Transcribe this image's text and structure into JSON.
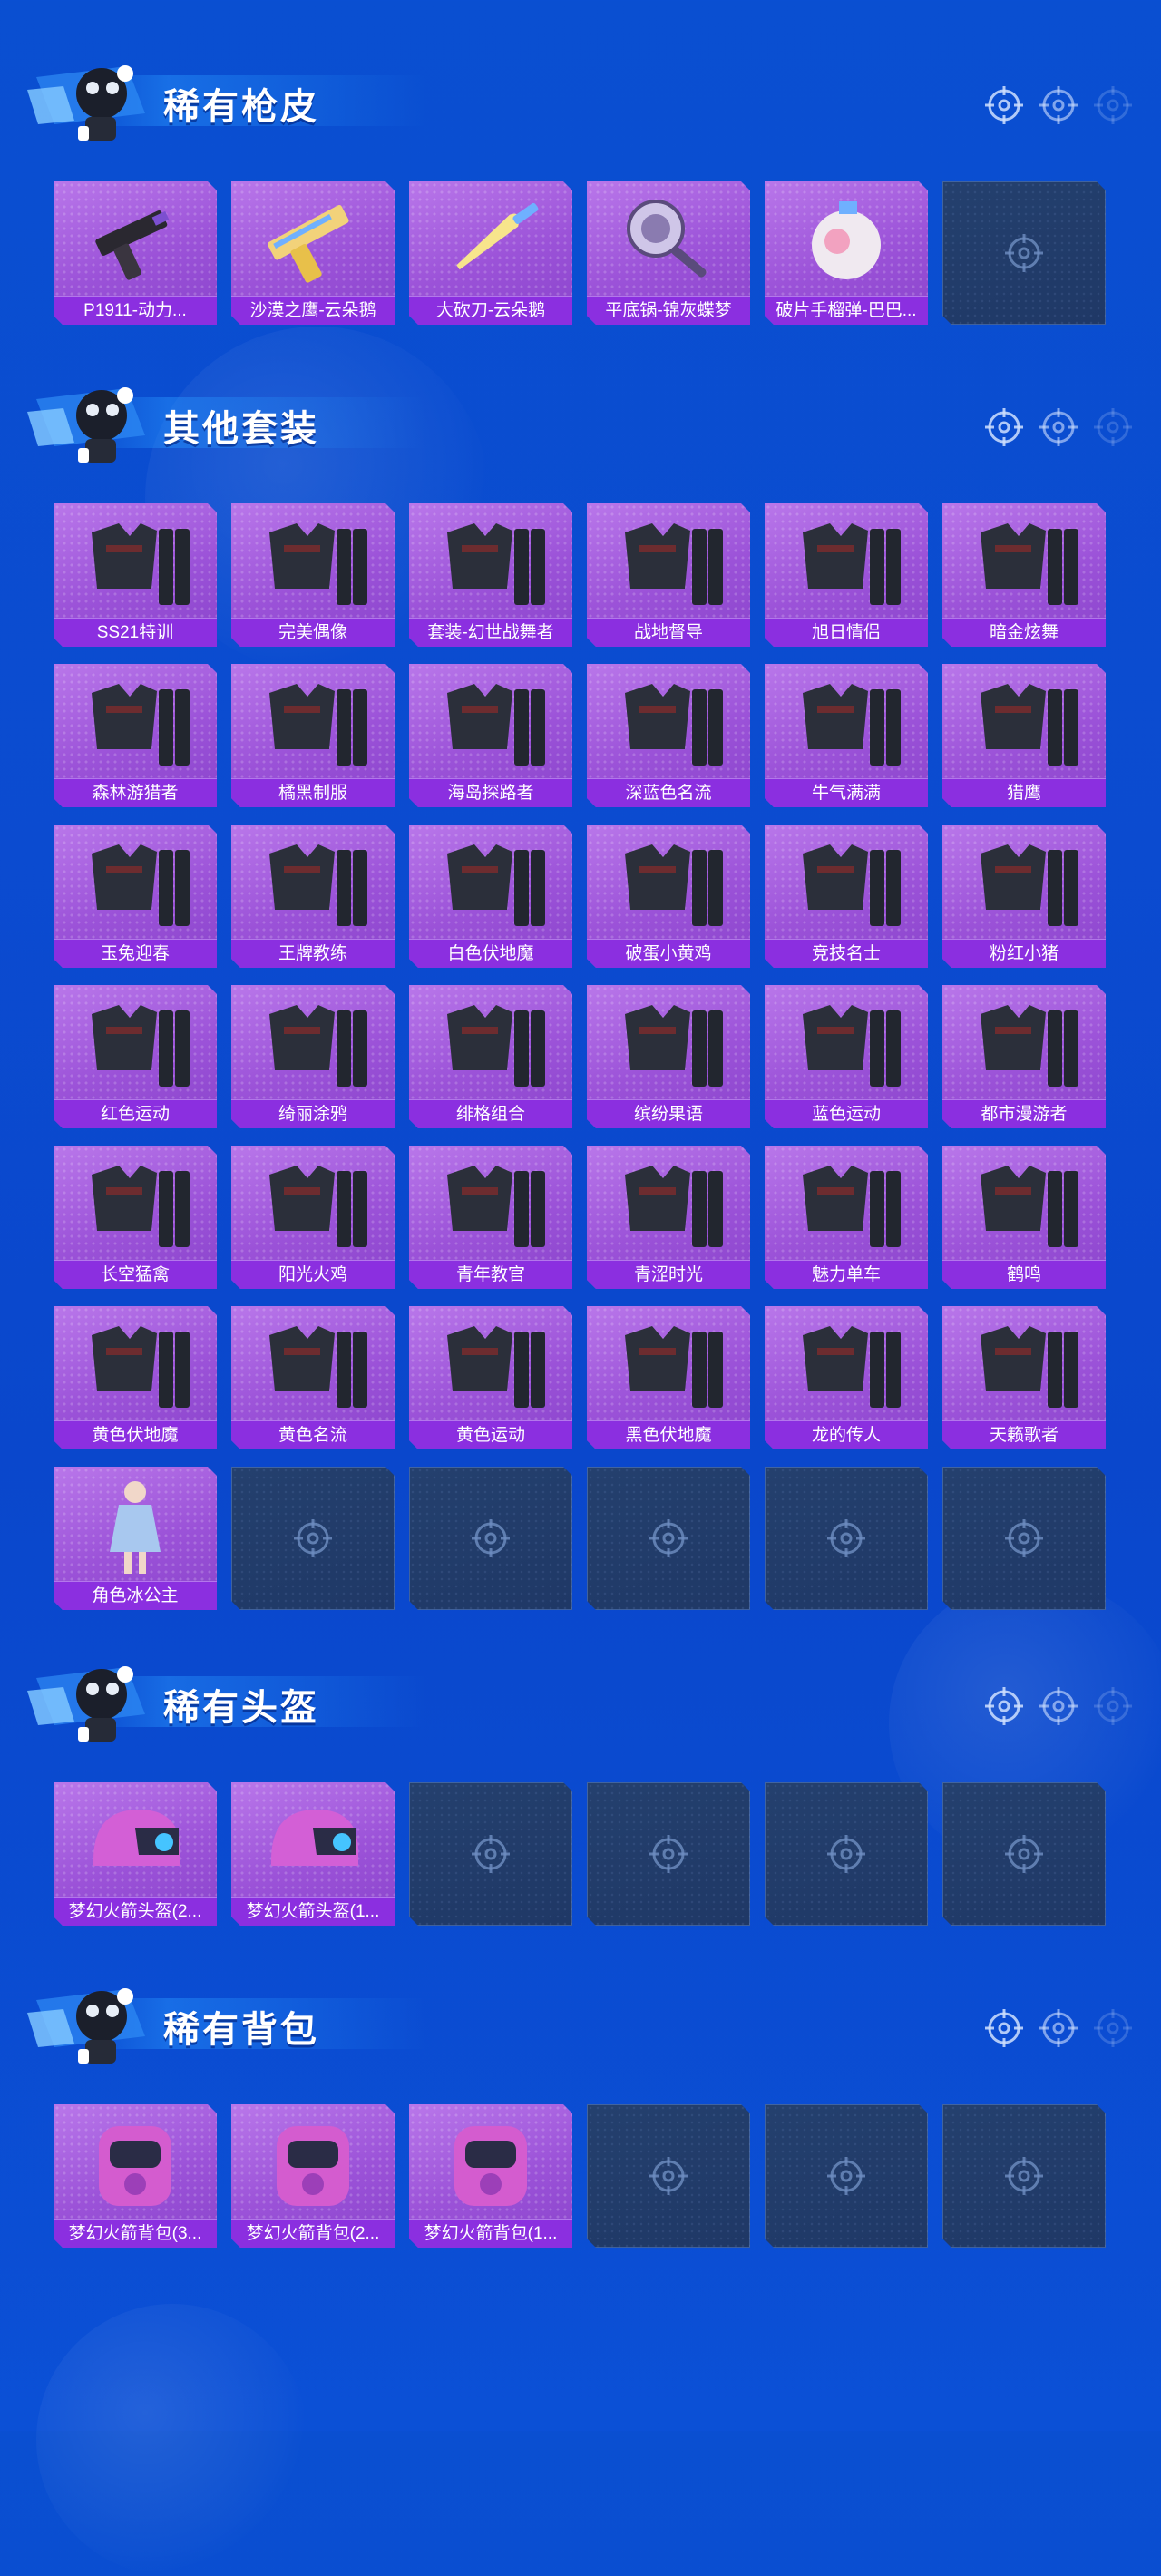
{
  "sections": [
    {
      "title": "稀有枪皮",
      "items": [
        {
          "label": "P1911-动力...",
          "icon": "pistol-icon"
        },
        {
          "label": "沙漠之鹰-云朵鹅",
          "icon": "desert-eagle-icon"
        },
        {
          "label": "大砍刀-云朵鹅",
          "icon": "machete-icon"
        },
        {
          "label": "平底锅-锦灰蝶梦",
          "icon": "frying-pan-icon"
        },
        {
          "label": "破片手榴弹-巴巴...",
          "icon": "grenade-icon"
        },
        {
          "label": "",
          "icon": ""
        }
      ]
    },
    {
      "title": "其他套装",
      "items": [
        {
          "label": "SS21特训",
          "icon": "outfit-icon"
        },
        {
          "label": "完美偶像",
          "icon": "outfit-icon"
        },
        {
          "label": "套装-幻世战舞者",
          "icon": "outfit-icon"
        },
        {
          "label": "战地督导",
          "icon": "outfit-icon"
        },
        {
          "label": "旭日情侣",
          "icon": "outfit-icon"
        },
        {
          "label": "暗金炫舞",
          "icon": "outfit-icon"
        },
        {
          "label": "森林游猎者",
          "icon": "outfit-icon"
        },
        {
          "label": "橘黑制服",
          "icon": "outfit-icon"
        },
        {
          "label": "海岛探路者",
          "icon": "outfit-icon"
        },
        {
          "label": "深蓝色名流",
          "icon": "outfit-icon"
        },
        {
          "label": "牛气满满",
          "icon": "outfit-icon"
        },
        {
          "label": "猎鹰",
          "icon": "outfit-icon"
        },
        {
          "label": "玉兔迎春",
          "icon": "outfit-icon"
        },
        {
          "label": "王牌教练",
          "icon": "outfit-icon"
        },
        {
          "label": "白色伏地魔",
          "icon": "outfit-icon"
        },
        {
          "label": "破蛋小黄鸡",
          "icon": "outfit-icon"
        },
        {
          "label": "竞技名士",
          "icon": "outfit-icon"
        },
        {
          "label": "粉红小猪",
          "icon": "outfit-icon"
        },
        {
          "label": "红色运动",
          "icon": "outfit-icon"
        },
        {
          "label": "绮丽涂鸦",
          "icon": "outfit-icon"
        },
        {
          "label": "绯格组合",
          "icon": "outfit-icon"
        },
        {
          "label": "缤纷果语",
          "icon": "outfit-icon"
        },
        {
          "label": "蓝色运动",
          "icon": "outfit-icon"
        },
        {
          "label": "都市漫游者",
          "icon": "outfit-icon"
        },
        {
          "label": "长空猛禽",
          "icon": "outfit-icon"
        },
        {
          "label": "阳光火鸡",
          "icon": "outfit-icon"
        },
        {
          "label": "青年教官",
          "icon": "outfit-icon"
        },
        {
          "label": "青涩时光",
          "icon": "outfit-icon"
        },
        {
          "label": "魅力单车",
          "icon": "outfit-icon"
        },
        {
          "label": "鹤鸣",
          "icon": "outfit-icon"
        },
        {
          "label": "黄色伏地魔",
          "icon": "outfit-icon"
        },
        {
          "label": "黄色名流",
          "icon": "outfit-icon"
        },
        {
          "label": "黄色运动",
          "icon": "outfit-icon"
        },
        {
          "label": "黑色伏地魔",
          "icon": "outfit-icon"
        },
        {
          "label": "龙的传人",
          "icon": "outfit-icon"
        },
        {
          "label": "天籁歌者",
          "icon": "outfit-icon"
        },
        {
          "label": "角色冰公主",
          "icon": "character-icon"
        },
        {
          "label": "",
          "icon": ""
        },
        {
          "label": "",
          "icon": ""
        },
        {
          "label": "",
          "icon": ""
        },
        {
          "label": "",
          "icon": ""
        },
        {
          "label": "",
          "icon": ""
        }
      ]
    },
    {
      "title": "稀有头盔",
      "items": [
        {
          "label": "梦幻火箭头盔(2...",
          "icon": "helmet-icon"
        },
        {
          "label": "梦幻火箭头盔(1...",
          "icon": "helmet-icon"
        },
        {
          "label": "",
          "icon": ""
        },
        {
          "label": "",
          "icon": ""
        },
        {
          "label": "",
          "icon": ""
        },
        {
          "label": "",
          "icon": ""
        }
      ]
    },
    {
      "title": "稀有背包",
      "items": [
        {
          "label": "梦幻火箭背包(3...",
          "icon": "backpack-icon"
        },
        {
          "label": "梦幻火箭背包(2...",
          "icon": "backpack-icon"
        },
        {
          "label": "梦幻火箭背包(1...",
          "icon": "backpack-icon"
        },
        {
          "label": "",
          "icon": ""
        },
        {
          "label": "",
          "icon": ""
        },
        {
          "label": "",
          "icon": ""
        }
      ]
    }
  ],
  "colors": {
    "background": "#0a4fd1",
    "tile_purple": "#9b52d8",
    "label_purple": "#8b2fe0",
    "empty_slot": "#24406e"
  }
}
